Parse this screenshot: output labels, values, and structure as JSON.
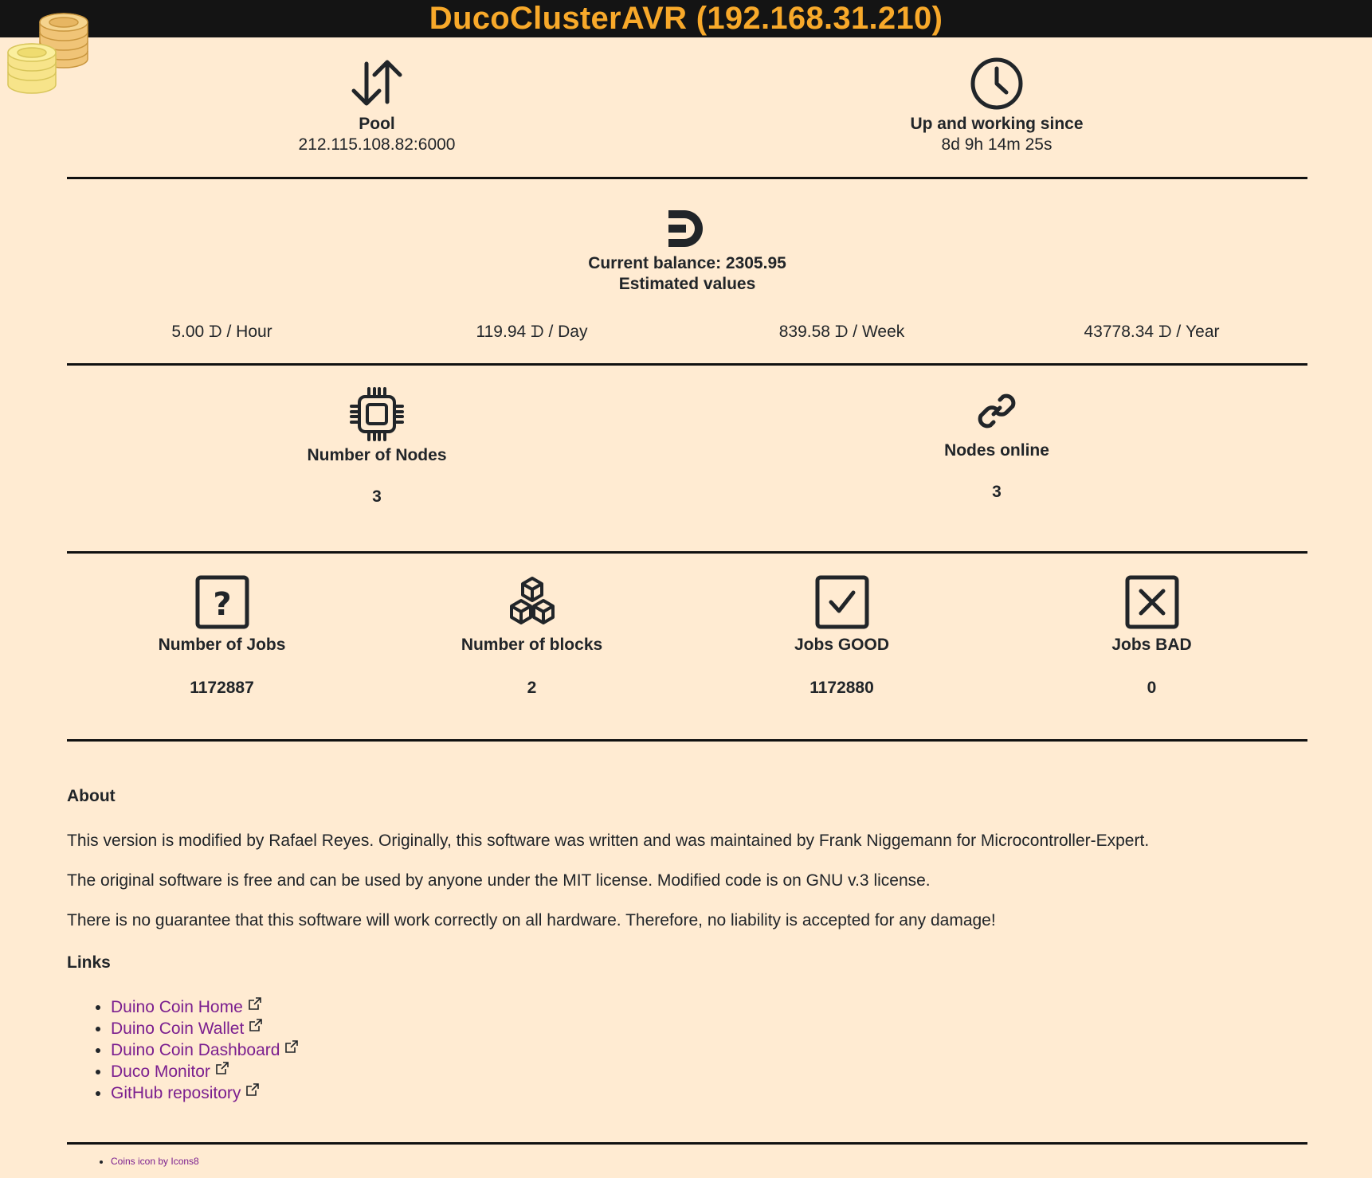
{
  "header": {
    "title": "DucoClusterAVR (192.168.31.210)"
  },
  "pool": {
    "label": "Pool",
    "value": "212.115.108.82:6000"
  },
  "uptime": {
    "label": "Up and working since",
    "value": "8d 9h 14m 25s"
  },
  "balance": {
    "current": "Current balance: 2305.95",
    "estimated_label": "Estimated values",
    "estimates": [
      {
        "amount": "5.00",
        "unit": "/ Hour"
      },
      {
        "amount": "119.94",
        "unit": "/ Day"
      },
      {
        "amount": "839.58",
        "unit": "/ Week"
      },
      {
        "amount": "43778.34",
        "unit": "/ Year"
      }
    ],
    "symbol": "ᗪ"
  },
  "nodes": {
    "count_label": "Number of Nodes",
    "count_value": "3",
    "online_label": "Nodes online",
    "online_value": "3"
  },
  "jobs": {
    "total_label": "Number of Jobs",
    "total_value": "1172887",
    "blocks_label": "Number of blocks",
    "blocks_value": "2",
    "good_label": "Jobs GOOD",
    "good_value": "1172880",
    "bad_label": "Jobs BAD",
    "bad_value": "0"
  },
  "about": {
    "heading": "About",
    "p1": "This version is modified by Rafael Reyes. Originally, this software was written and was maintained by Frank Niggemann for Microcontroller-Expert.",
    "p2": "The original software is free and can be used by anyone under the MIT license. Modified code is on GNU v.3 license.",
    "p3": "There is no guarantee that this software will work correctly on all hardware. Therefore, no liability is accepted for any damage!"
  },
  "links": {
    "heading": "Links",
    "items": [
      "Duino Coin Home",
      "Duino Coin Wallet",
      "Duino Coin Dashboard",
      "Duco Monitor",
      "GitHub repository"
    ]
  },
  "footer": {
    "credit": "Coins icon by Icons8"
  },
  "colors": {
    "background": "#ffebd2",
    "topbar": "#141414",
    "title": "#f8a92a",
    "link": "#7b1f8f"
  }
}
